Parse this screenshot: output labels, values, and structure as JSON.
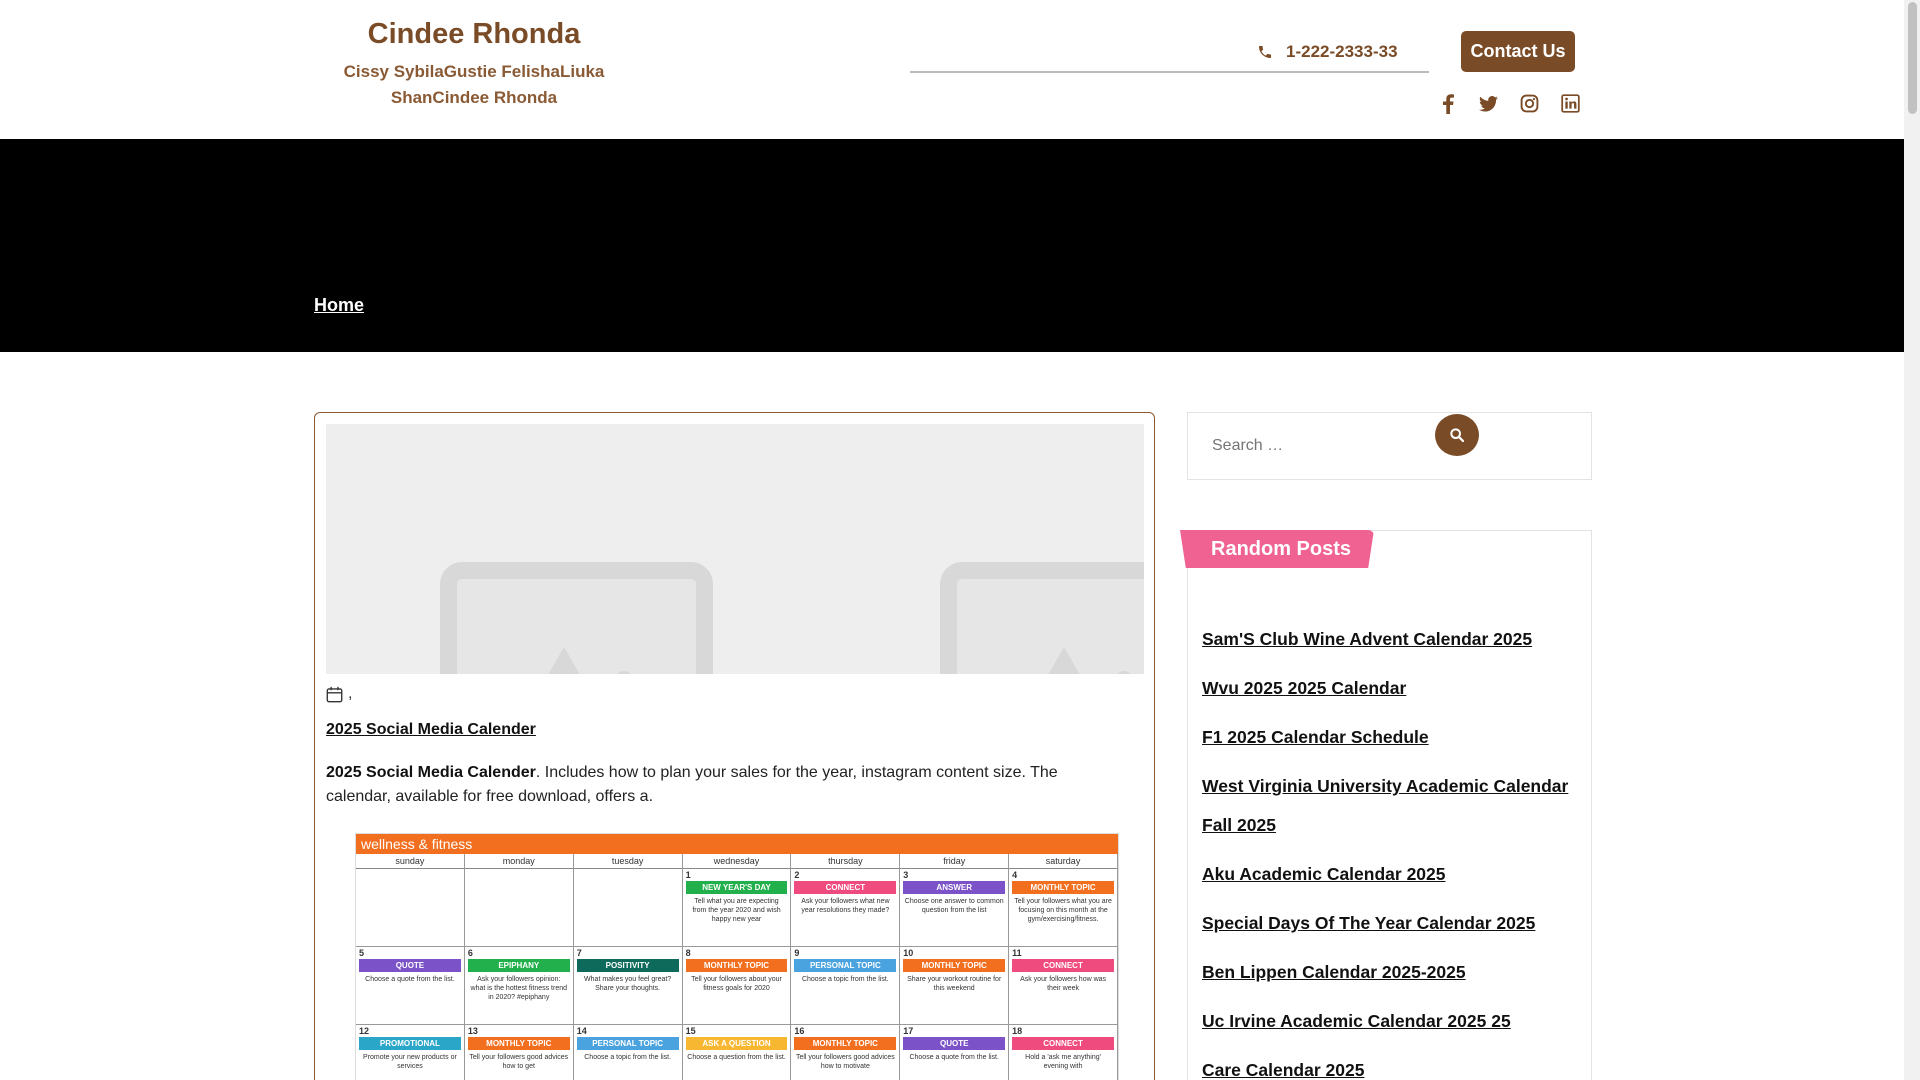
{
  "header": {
    "site_title": "Cindee Rhonda",
    "tagline": "Cissy SybilaGustie FelishaLiuka ShanCindee Rhonda",
    "phone": "1-222-2333-33",
    "contact_button": "Contact Us",
    "social_icons": [
      "facebook-icon",
      "twitter-icon",
      "instagram-icon",
      "linkedin-icon"
    ]
  },
  "breadcrumb": {
    "home": "Home"
  },
  "article": {
    "meta": ",",
    "title_link": "2025 Social Media Calender",
    "excerpt_bold": "2025 Social Media Calender",
    "excerpt_rest": ". Includes how to plan your sales for the year, instagram content size. The calendar, available for free download, offers a."
  },
  "calendar_image": {
    "heading": "wellness & fitness",
    "days": [
      "sunday",
      "monday",
      "tuesday",
      "wednesday",
      "thursday",
      "friday",
      "saturday"
    ],
    "cells": [
      {
        "num": "",
        "tag": "",
        "color": "",
        "text": ""
      },
      {
        "num": "",
        "tag": "",
        "color": "",
        "text": ""
      },
      {
        "num": "",
        "tag": "",
        "color": "",
        "text": ""
      },
      {
        "num": "1",
        "tag": "NEW YEAR'S DAY",
        "color": "#21b04b",
        "text": "Tell what you are expecting from the year 2020 and wish happy new year"
      },
      {
        "num": "2",
        "tag": "CONNECT",
        "color": "#ef4b7e",
        "text": "Ask your followers what new year resolutions they made?"
      },
      {
        "num": "3",
        "tag": "ANSWER",
        "color": "#7b52c7",
        "text": "Choose one answer to common question from the list"
      },
      {
        "num": "4",
        "tag": "MONTHLY TOPIC",
        "color": "#f36f20",
        "text": "Tell your followers what you are focusing on this month at the gym/exercising/fitness."
      },
      {
        "num": "5",
        "tag": "QUOTE",
        "color": "#7b52c7",
        "text": "Choose a quote from the list."
      },
      {
        "num": "6",
        "tag": "EPIPHANY",
        "color": "#21b04b",
        "text": "Ask your followers opinion: what is the hottest fitness trend in 2020? #epiphany"
      },
      {
        "num": "7",
        "tag": "POSITIVITY",
        "color": "#0e6b5c",
        "text": "What makes you feel great? Share your thoughts."
      },
      {
        "num": "8",
        "tag": "MONTHLY TOPIC",
        "color": "#f36f20",
        "text": "Tell your followers about your fitness goals for 2020"
      },
      {
        "num": "9",
        "tag": "PERSONAL TOPIC",
        "color": "#4aa3df",
        "text": "Choose a topic from the list."
      },
      {
        "num": "10",
        "tag": "MONTHLY TOPIC",
        "color": "#f36f20",
        "text": "Share your workout routine for this weekend"
      },
      {
        "num": "11",
        "tag": "CONNECT",
        "color": "#ef4b7e",
        "text": "Ask your followers how was their week"
      },
      {
        "num": "12",
        "tag": "PROMOTIONAL",
        "color": "#2aa6c9",
        "text": "Promote your new products or services"
      },
      {
        "num": "13",
        "tag": "MONTHLY TOPIC",
        "color": "#f36f20",
        "text": "Tell your followers good advices how to get"
      },
      {
        "num": "14",
        "tag": "PERSONAL TOPIC",
        "color": "#4aa3df",
        "text": "Choose a topic from the list."
      },
      {
        "num": "15",
        "tag": "ASK A QUESTION",
        "color": "#f7b731",
        "text": "Choose a question from the list."
      },
      {
        "num": "16",
        "tag": "MONTHLY TOPIC",
        "color": "#f36f20",
        "text": "Tell your followers good advices how to motivate"
      },
      {
        "num": "17",
        "tag": "QUOTE",
        "color": "#7b52c7",
        "text": "Choose a quote from the list."
      },
      {
        "num": "18",
        "tag": "CONNECT",
        "color": "#ef4b7e",
        "text": "Hold a 'ask me anything' evening with"
      }
    ]
  },
  "sidebar": {
    "search_placeholder": "Search …",
    "random_posts_title": "Random Posts",
    "random_posts": [
      "Sam'S Club Wine Advent Calendar 2025",
      "Wvu 2025 2025 Calendar",
      "F1 2025 Calendar Schedule",
      "West Virginia University Academic Calendar Fall 2025",
      "Aku Academic Calendar 2025",
      "Special Days Of The Year Calendar 2025",
      "Ben Lippen Calendar 2025-2025",
      "Uc Irvine Academic Calendar 2025 25",
      "Care Calendar 2025"
    ]
  },
  "colors": {
    "brand": "#7a4b27",
    "accent": "#f06292",
    "hero": "#000000"
  }
}
